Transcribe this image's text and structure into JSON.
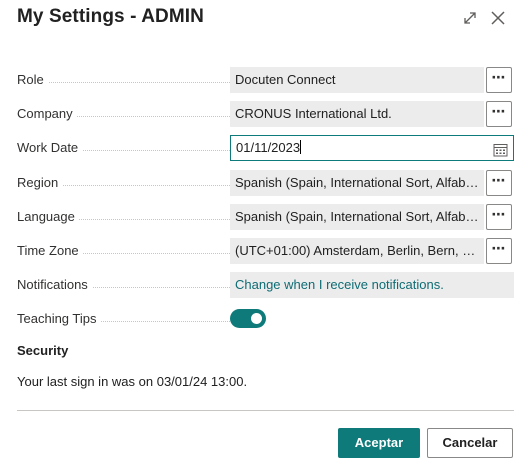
{
  "dialog": {
    "title": "My Settings - ADMIN",
    "expand_icon": "expand-icon",
    "close_icon": "close-icon"
  },
  "fields": {
    "role": {
      "label": "Role",
      "value": "Docuten Connect",
      "lookup": "⋯"
    },
    "company": {
      "label": "Company",
      "value": "CRONUS International Ltd.",
      "lookup": "⋯"
    },
    "work_date": {
      "label": "Work Date",
      "value": "01/11/2023",
      "icon": "calendar-icon"
    },
    "region": {
      "label": "Region",
      "value": "Spanish (Spain, International Sort, Alfabet...",
      "lookup": "⋯"
    },
    "language": {
      "label": "Language",
      "value": "Spanish (Spain, International Sort, Alfabet...",
      "lookup": "⋯"
    },
    "time_zone": {
      "label": "Time Zone",
      "value": "(UTC+01:00) Amsterdam, Berlin, Bern, Ro...",
      "lookup": "⋯"
    },
    "notifications": {
      "label": "Notifications",
      "value": "Change when I receive notifications."
    },
    "teaching_tips": {
      "label": "Teaching Tips",
      "enabled": true
    }
  },
  "security": {
    "heading": "Security",
    "last_sign_in": "Your last sign in was on 03/01/24 13:00."
  },
  "buttons": {
    "ok": "Aceptar",
    "cancel": "Cancelar"
  },
  "colors": {
    "accent": "#0f7a7a",
    "link": "#0f6c74",
    "field_bg": "#ececec"
  }
}
